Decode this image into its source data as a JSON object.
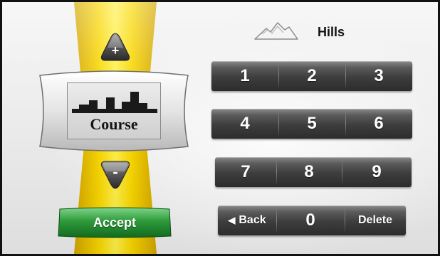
{
  "program": {
    "label": "Hills",
    "icon": "hills-icon"
  },
  "selector": {
    "label": "Course",
    "icon": "course-profile-icon",
    "up_icon": "plus-arrow-up-icon",
    "down_icon": "minus-arrow-down-icon",
    "up_symbol": "+",
    "down_symbol": "-"
  },
  "accept": {
    "label": "Accept"
  },
  "keypad": {
    "keys": [
      "1",
      "2",
      "3",
      "4",
      "5",
      "6",
      "7",
      "8",
      "9"
    ],
    "back_label": "Back",
    "back_icon": "left-triangle-icon",
    "zero": "0",
    "delete_label": "Delete"
  },
  "colors": {
    "band_yellow": "#f8d600",
    "accept_green": "#2e9a3a",
    "key_dark": "#3d3d3d"
  }
}
